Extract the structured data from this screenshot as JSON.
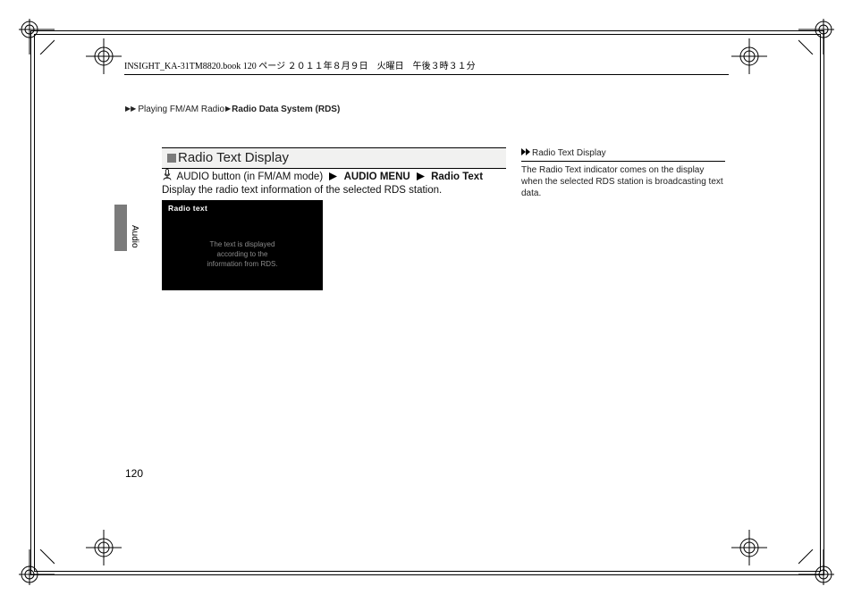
{
  "bookline": "INSIGHT_KA-31TM8820.book  120 ページ  ２０１１年８月９日　火曜日　午後３時３１分",
  "breadcrumb": {
    "arrows": "▶▶",
    "p1": "Playing FM/AM Radio",
    "arrow2": "▶",
    "p2": "Radio Data System (RDS)"
  },
  "section_title": "Radio Text Display",
  "procedure": {
    "pre": " AUDIO button (in FM/AM mode) ",
    "step1": "AUDIO MENU",
    "step2": "Radio Text"
  },
  "description": "Display the radio text information of the selected RDS station.",
  "screenshot": {
    "label": "Radio text",
    "line1": "The text is displayed",
    "line2": "according to the",
    "line3": "information from RDS."
  },
  "side_tab_label": "Audio",
  "sidebar": {
    "title": "Radio Text Display",
    "body": "The Radio Text indicator comes on the display when the selected RDS station is broadcasting text data."
  },
  "page_number": "120"
}
